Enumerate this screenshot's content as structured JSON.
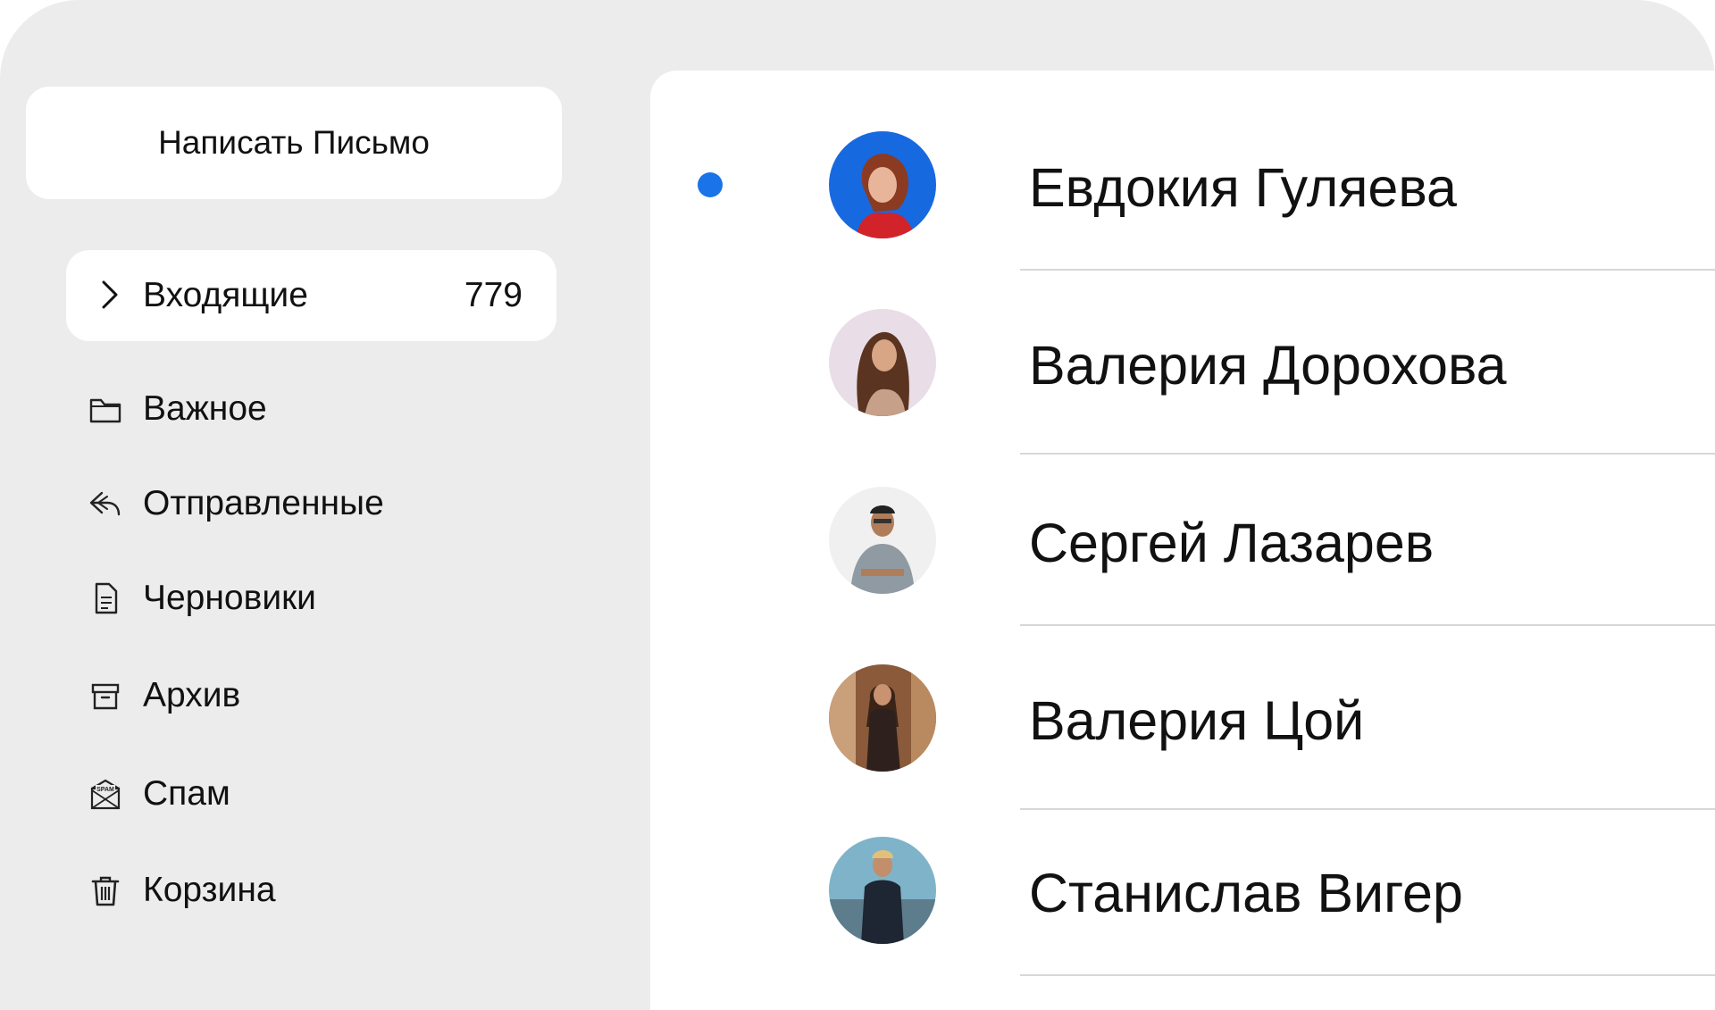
{
  "sidebar": {
    "compose_label": "Написать Письмо",
    "inbox": {
      "label": "Входящие",
      "count": "779",
      "icon": "chevron-right-icon"
    },
    "items": [
      {
        "label": "Важное",
        "icon": "folder-icon"
      },
      {
        "label": "Отправленные",
        "icon": "reply-icon"
      },
      {
        "label": "Черновики",
        "icon": "document-icon"
      },
      {
        "label": "Архив",
        "icon": "archive-box-icon"
      },
      {
        "label": "Спам",
        "icon": "spam-envelope-icon",
        "icon_text": "SPAM"
      },
      {
        "label": "Корзина",
        "icon": "trash-icon"
      }
    ]
  },
  "messages": [
    {
      "sender": "Евдокия Гуляева",
      "unread": true,
      "avatar_bg": "#1769e0"
    },
    {
      "sender": "Валерия Дорохова",
      "unread": false,
      "avatar_bg": "#e9dde7"
    },
    {
      "sender": "Сергей Лазарев",
      "unread": false,
      "avatar_bg": "#f0f0f0"
    },
    {
      "sender": "Валерия Цой",
      "unread": false,
      "avatar_bg": "#8a5a3a"
    },
    {
      "sender": "Станислав Вигер",
      "unread": false,
      "avatar_bg": "#7fb3c9"
    }
  ],
  "colors": {
    "accent": "#1a73e8",
    "sidebar_bg": "#ececec",
    "panel_bg": "#ffffff"
  }
}
